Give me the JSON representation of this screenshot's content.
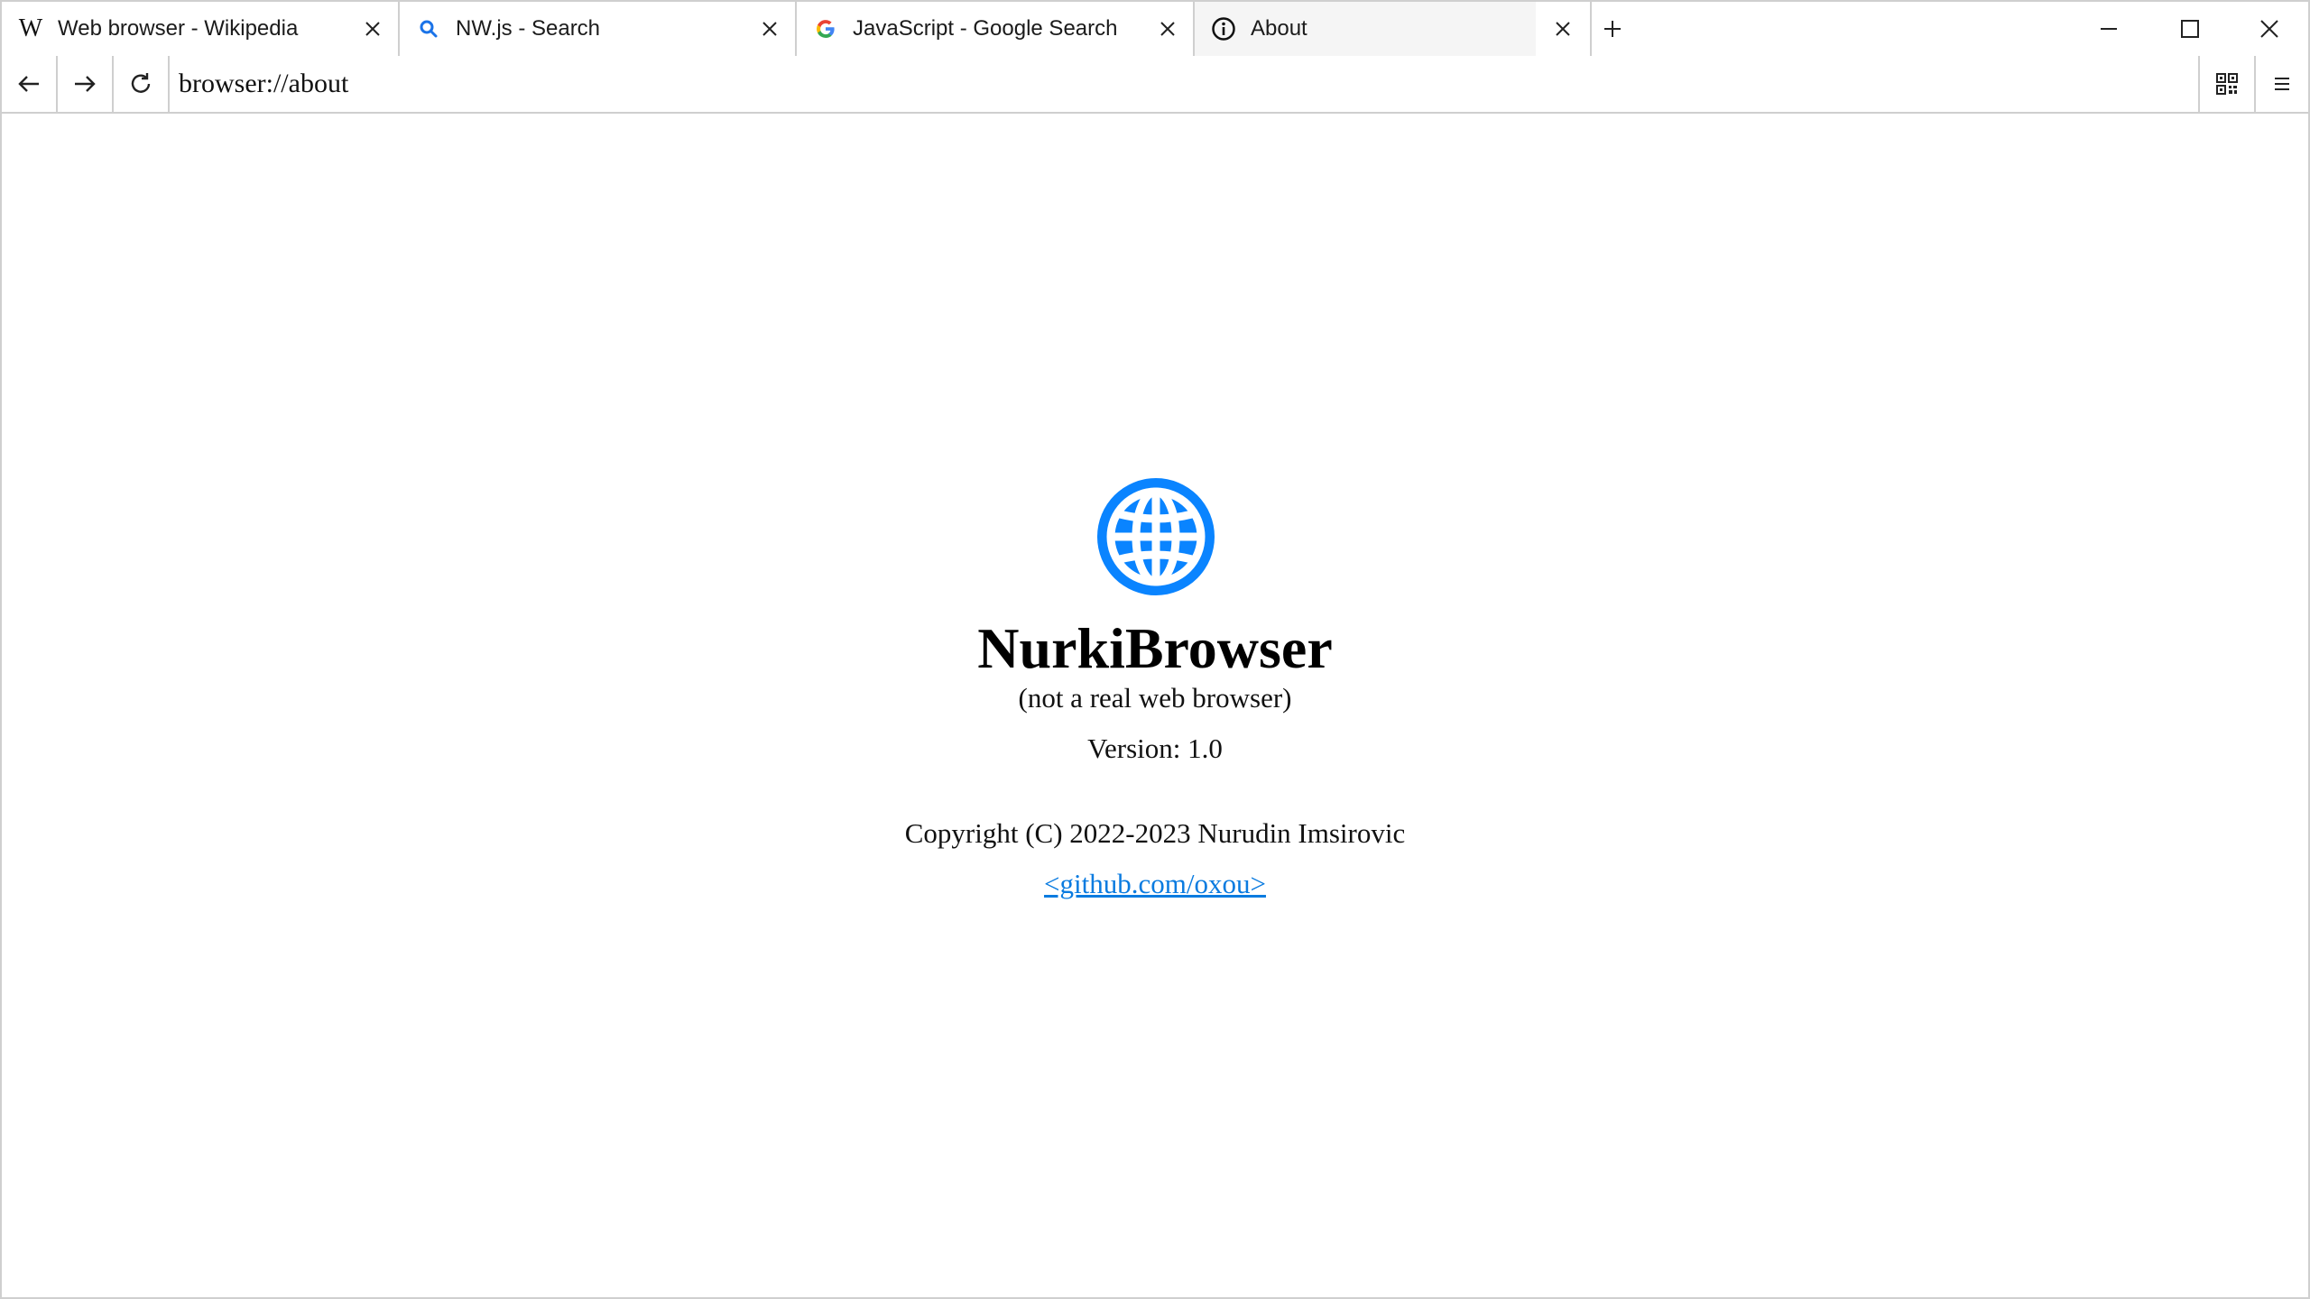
{
  "tabs": [
    {
      "label": "Web browser - Wikipedia",
      "icon": "wikipedia-icon",
      "active": false
    },
    {
      "label": "NW.js - Search",
      "icon": "search-icon",
      "active": false
    },
    {
      "label": "JavaScript - Google Search",
      "icon": "google-icon",
      "active": false
    },
    {
      "label": "About",
      "icon": "info-icon",
      "active": true
    }
  ],
  "address_bar": {
    "value": "browser://about"
  },
  "about": {
    "app_name": "NurkiBrowser",
    "subtitle": "(not a real web browser)",
    "version": "Version: 1.0",
    "copyright": "Copyright (C) 2022-2023 Nurudin Imsirovic",
    "link": "<github.com/oxou>"
  },
  "colors": {
    "accent": "#0a84ff",
    "link": "#0a7be0",
    "border": "#cfcfcf"
  }
}
